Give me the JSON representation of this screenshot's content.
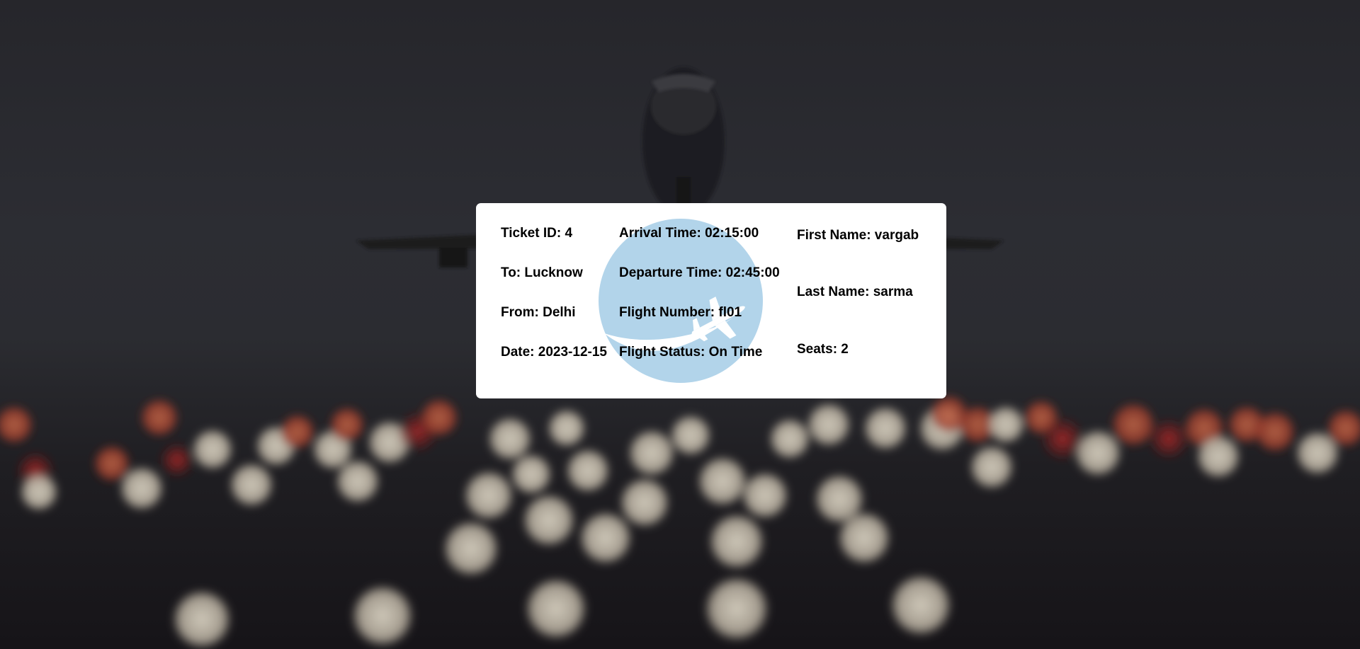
{
  "background": {
    "image_subject": "airplane-taking-off-at-night-runway-lights"
  },
  "logo": {
    "icon": "plane-globe-icon",
    "circle_color": "#b2d4ea"
  },
  "ticket": {
    "ticket_id": "Ticket ID: 4",
    "to": "To: Lucknow",
    "from": "From: Delhi",
    "date": "Date: 2023-12-15",
    "arrival_time": "Arrival Time: 02:15:00",
    "departure_time": "Departure Time: 02:45:00",
    "flight_number": "Flight Number: fl01",
    "flight_status": "Flight Status: On Time",
    "first_name": "First Name: vargab",
    "last_name": "Last Name: sarma",
    "seats": "Seats: 2"
  }
}
